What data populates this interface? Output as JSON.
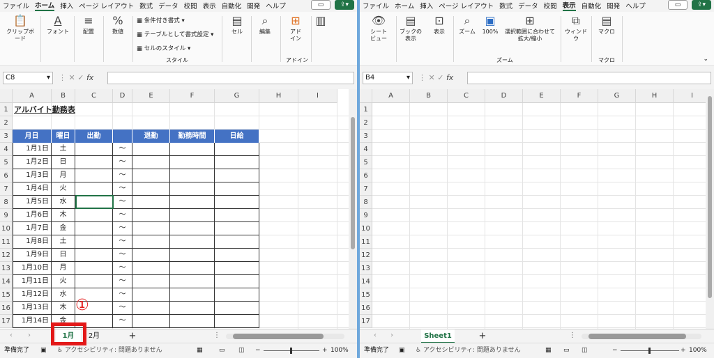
{
  "left": {
    "menu": [
      "ファイル",
      "ホーム",
      "挿入",
      "ページ レイアウト",
      "数式",
      "データ",
      "校閲",
      "表示",
      "自動化",
      "開発",
      "ヘルプ"
    ],
    "menu_active": "ホーム",
    "ribbon": {
      "clipboard": "クリップボード",
      "font": "フォント",
      "align": "配置",
      "number": "数値",
      "cond_format": "条件付き書式",
      "table_format": "テーブルとして書式設定",
      "cell_style": "セルのスタイル",
      "style_group": "スタイル",
      "cells": "セル",
      "edit": "編集",
      "addin": "アド\nイン",
      "addin_group": "アドイン"
    },
    "name_box": "C8",
    "columns": [
      "A",
      "B",
      "C",
      "D",
      "E",
      "F",
      "G",
      "H",
      "I"
    ],
    "rows": [
      "1",
      "2",
      "3",
      "4",
      "5",
      "6",
      "7",
      "8",
      "9",
      "10",
      "11",
      "12",
      "13",
      "14",
      "15",
      "16",
      "17"
    ],
    "title": "アルバイト勤務表",
    "headers": [
      "月日",
      "曜日",
      "出勤",
      "",
      "退勤",
      "勤務時間",
      "日給"
    ],
    "days": [
      [
        "1月1日",
        "土"
      ],
      [
        "1月2日",
        "日"
      ],
      [
        "1月3日",
        "月"
      ],
      [
        "1月4日",
        "火"
      ],
      [
        "1月5日",
        "水"
      ],
      [
        "1月6日",
        "木"
      ],
      [
        "1月7日",
        "金"
      ],
      [
        "1月8日",
        "土"
      ],
      [
        "1月9日",
        "日"
      ],
      [
        "1月10日",
        "月"
      ],
      [
        "1月11日",
        "火"
      ],
      [
        "1月12日",
        "水"
      ],
      [
        "1月13日",
        "木"
      ],
      [
        "1月14日",
        "金"
      ]
    ],
    "tilde": "～",
    "tabs": [
      "1月",
      "2月"
    ],
    "add_sheet": "+",
    "status_ready": "準備完了",
    "accessibility": "アクセシビリティ: 問題ありません",
    "zoom": "100%",
    "annotation": "①"
  },
  "right": {
    "menu": [
      "ファイル",
      "ホーム",
      "挿入",
      "ページ レイアウト",
      "数式",
      "データ",
      "校閲",
      "表示",
      "自動化",
      "開発",
      "ヘルプ"
    ],
    "menu_active": "表示",
    "ribbon": {
      "sheet_view": "シート\nビュー",
      "book_view": "ブックの\n表示",
      "show": "表示",
      "zoom": "ズーム",
      "zoom100": "100%",
      "zoom_sel": "選択範囲に合わせて\n拡大/縮小",
      "zoom_group": "ズーム",
      "window": "ウィンドウ",
      "macro": "マクロ",
      "macro_group": "マクロ"
    },
    "name_box": "B4",
    "columns": [
      "A",
      "B",
      "C",
      "D",
      "E",
      "F",
      "G",
      "H",
      "I"
    ],
    "rows": [
      "1",
      "2",
      "3",
      "4",
      "5",
      "6",
      "7",
      "8",
      "9",
      "10",
      "11",
      "12",
      "13",
      "14",
      "15",
      "16",
      "17"
    ],
    "tabs": [
      "Sheet1"
    ],
    "add_sheet": "+",
    "status_ready": "準備完了",
    "accessibility": "アクセシビリティ: 問題ありません",
    "zoom": "100%"
  },
  "colors": {
    "accent": "#217346",
    "table_header": "#4472c4",
    "annotation": "#e31919"
  }
}
